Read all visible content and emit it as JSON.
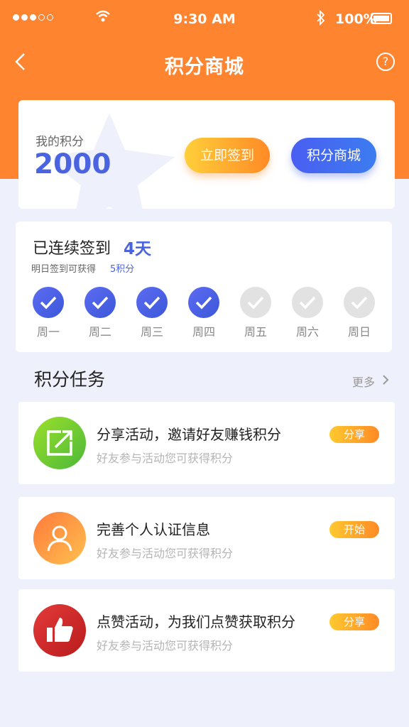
{
  "status_bar": {
    "time": "9:30 AM",
    "battery": "100%"
  },
  "nav": {
    "title": "积分商城",
    "help": "?"
  },
  "points": {
    "label": "我的积分",
    "value": "2000",
    "sign_button": "立即签到",
    "mall_button": "积分商城"
  },
  "checkin": {
    "title": "已连续签到",
    "days": "4天",
    "subtitle": "明日签到可获得",
    "subtitle_points": "5积分",
    "week": [
      {
        "label": "周一",
        "checked": true
      },
      {
        "label": "周二",
        "checked": true
      },
      {
        "label": "周三",
        "checked": true
      },
      {
        "label": "周四",
        "checked": true
      },
      {
        "label": "周五",
        "checked": false
      },
      {
        "label": "周六",
        "checked": false
      },
      {
        "label": "周日",
        "checked": false
      }
    ]
  },
  "tasks": {
    "title": "积分任务",
    "more": "更多",
    "items": [
      {
        "title": "分享活动，邀请好友赚钱积分",
        "desc": "好友参与活动您可获得积分",
        "button": "分享",
        "icon": "share-icon",
        "color": "#7ac93a"
      },
      {
        "title": "完善个人认证信息",
        "desc": "好友参与活动您可获得积分",
        "button": "开始",
        "icon": "user-icon",
        "color": "#ff9a3a"
      },
      {
        "title": "点赞活动，为我们点赞获取积分",
        "desc": "好友参与活动您可获得积分",
        "button": "分享",
        "icon": "thumbs-up-icon",
        "color": "#d42a2a"
      }
    ]
  },
  "colors": {
    "header": "#ff8430",
    "accent_blue": "#4a63e0",
    "accent_orange": "#ff8a25"
  }
}
